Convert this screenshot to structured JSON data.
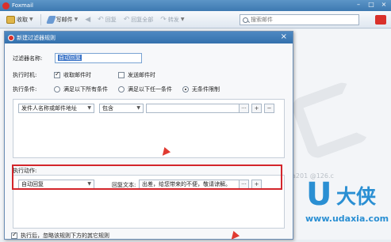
{
  "app": {
    "title": "Foxmail"
  },
  "toolbar": {
    "inbox": "收取",
    "write": "写邮件",
    "reply": "回复",
    "reply_all": "回复全部",
    "forward": "转发",
    "search_placeholder": "搜索邮件"
  },
  "background": {
    "email_fragment": "a201",
    "email_fragment2": "@126.c"
  },
  "watermark": {
    "u": "U",
    "brand": "大侠",
    "url": "www.udaxia.com"
  },
  "dialog": {
    "title": "新建过滤器规则",
    "close": "×",
    "name_label": "过滤器名称:",
    "name_value": "自动回复",
    "when_label": "执行时机:",
    "when_receive": "收取邮件时",
    "when_send": "发送邮件时",
    "cond_label": "执行条件:",
    "cond_all": "满足以下所有条件",
    "cond_any": "满足以下任一条件",
    "cond_none": "无条件限制",
    "cond_field": "发件人名称或邮件地址",
    "cond_op": "包含",
    "more_btn": "···",
    "add_btn": "+",
    "remove_btn": "−",
    "action_label": "执行动作:",
    "action_type": "自动回复",
    "reply_text_label": "回复文本:",
    "reply_text_value": "出差，给您带来的不便，敬请谅解。",
    "footer_text": "执行后，忽略该规则下方的其它规则"
  },
  "colors": {
    "highlight": "#d3252b",
    "title_bar": "#3d79b1",
    "watermark": "#2a8fd3"
  }
}
